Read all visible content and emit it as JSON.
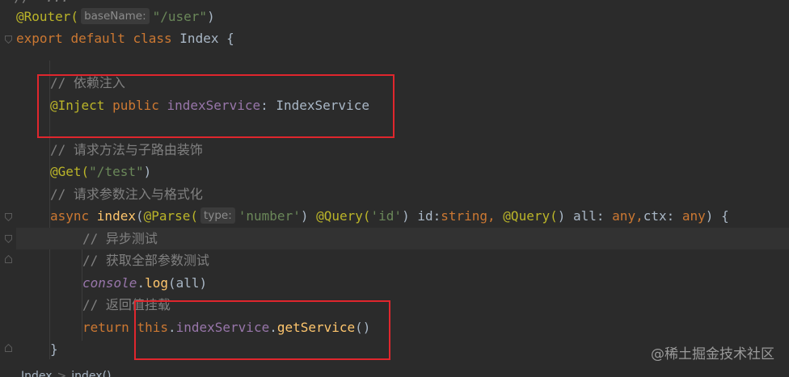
{
  "code": {
    "top_fragment": "//  ...",
    "l1": {
      "ann": "@Router(",
      "hint": "baseName:",
      "str": "\"/user\"",
      "close": ")"
    },
    "l2": {
      "export": "export ",
      "default": "default ",
      "class": "class ",
      "name": "Index {"
    },
    "l4": {
      "comment": "// 依赖注入"
    },
    "l5": {
      "ann": "@Inject",
      "public": " public ",
      "field": "indexService",
      "colon": ": ",
      "type": "IndexService"
    },
    "l7": {
      "comment": "// 请求方法与子路由装饰"
    },
    "l8": {
      "ann": "@Get(",
      "str": "\"/test\"",
      "close": ")"
    },
    "l9": {
      "comment": "// 请求参数注入与格式化"
    },
    "l10": {
      "async": "async ",
      "fn": "index",
      "p1": "(",
      "ann1": "@Parse(",
      "hint": "type:",
      "str1": "'number'",
      "p2": ") ",
      "ann2": "@Query(",
      "str2": "'id'",
      "p3": ") id:",
      "string": "string",
      "comma1": ", ",
      "ann3": "@Query(",
      "p4": ") all: ",
      "any1": "any",
      "comma2": ",",
      "ctx": "ctx: ",
      "any2": "any",
      "p5": ") {"
    },
    "l11": {
      "comment": "// 异步测试"
    },
    "l12": {
      "comment": "// 获取全部参数测试"
    },
    "l13": {
      "console": "console",
      "dot": ".",
      "log": "log",
      "rest": "(all)"
    },
    "l14": {
      "comment": "// 返回值挂载"
    },
    "l15": {
      "return": "return ",
      "this": "this",
      "dot1": ".",
      "field": "indexService",
      "dot2": ".",
      "method": "getService",
      "parens": "()"
    },
    "l16": {
      "brace": "}"
    }
  },
  "breadcrumb": {
    "item1": "Index",
    "sep": ">",
    "item2": "index()"
  },
  "watermark": "@稀土掘金技术社区",
  "colors": {
    "background": "#2b2b2b",
    "keyword": "#cc7832",
    "annotation": "#bbb529",
    "string": "#6a8759",
    "comment": "#808080",
    "field": "#9876aa",
    "function": "#ffc66d",
    "highlight_box": "#e0262d"
  }
}
